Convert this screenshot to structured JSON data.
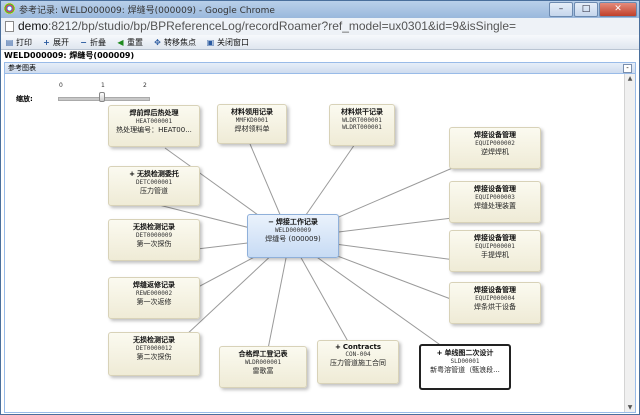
{
  "window": {
    "title": "参考记录: WELD000009: 焊缝号(000009) - Google Chrome",
    "url_host": "demo",
    "url_rest": ":8212/bp/studio/bp/BPReferenceLog/recordRoamer?ref_model=ux0301&id=9&isSingle="
  },
  "toolbar": [
    {
      "icon": "printer-icon",
      "label": "打印"
    },
    {
      "icon": "expand-icon",
      "label": "展开"
    },
    {
      "icon": "collapse-icon",
      "label": "折叠"
    },
    {
      "icon": "reset-icon",
      "label": "重置"
    },
    {
      "icon": "move-focus-icon",
      "label": "转移焦点"
    },
    {
      "icon": "close-window-icon",
      "label": "关闭窗口"
    }
  ],
  "record_title": "WELD000009: 焊缝号(000009)",
  "panel_title": "参考图表",
  "zoom": {
    "label": "缩放:",
    "ticks": [
      "0",
      "1",
      "2"
    ],
    "value": 1
  },
  "nodes": {
    "center": {
      "title": "焊接工作记录",
      "code": "WELD000009",
      "desc": "焊缝号 (000009)",
      "prefix": "−"
    },
    "n1": {
      "title": "焊前焊后热处理",
      "code": "HEAT000001",
      "desc": "热处理编号：HEAT00..."
    },
    "n2": {
      "title": "材料领用记录",
      "code": "MMFKD0001",
      "desc": "焊材领料单"
    },
    "n3": {
      "title": "材料烘干记录",
      "code": "WLDRT000001",
      "desc": "WLDRT000001"
    },
    "n4": {
      "title": "焊接设备管理",
      "code": "EQUIP000002",
      "desc": "逆焊焊机"
    },
    "n5": {
      "title": "无损检测委托",
      "code": "DETC000001",
      "desc": "压力管道",
      "prefix": "+"
    },
    "n6": {
      "title": "焊接设备管理",
      "code": "EQUIP000003",
      "desc": "焊缝处理装置"
    },
    "n7": {
      "title": "无损检测记录",
      "code": "DET0000009",
      "desc": "第一次探伤"
    },
    "n8": {
      "title": "焊接设备管理",
      "code": "EQUIP000001",
      "desc": "手提焊机"
    },
    "n9": {
      "title": "焊缝返修记录",
      "code": "REWE000002",
      "desc": "第一次返修"
    },
    "n10": {
      "title": "焊接设备管理",
      "code": "EQUIP000004",
      "desc": "焊条烘干设备"
    },
    "n11": {
      "title": "无损检测记录",
      "code": "DET0000012",
      "desc": "第二次探伤"
    },
    "n12": {
      "title": "合格焊工登记表",
      "code": "WLDR000001",
      "desc": "雷歌富"
    },
    "n13": {
      "title": "Contracts",
      "code": "CON-004",
      "desc": "压力管道施工合同",
      "prefix": "+"
    },
    "n14": {
      "title": "单线图二次设计",
      "code": "SLD00001",
      "desc": "新粤溶管道（甄浪段...",
      "prefix": "+"
    }
  },
  "colors": {
    "link": "#9a9a9a",
    "center_bg": "#c7dbf4",
    "node_bg": "#efebd6"
  }
}
